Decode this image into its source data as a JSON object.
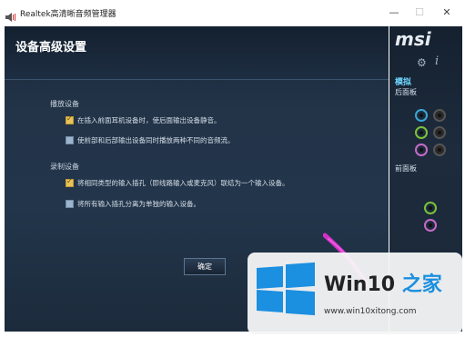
{
  "window": {
    "title": "Realtek高清晰音频管理器",
    "minimize_glyph": "—",
    "maximize_glyph": "☐",
    "close_glyph": "✕"
  },
  "page": {
    "title": "设备高级设置"
  },
  "playback": {
    "section_label": "播放设备",
    "options": [
      {
        "label": "在插入前面耳机设备时，使后面输出设备静音。",
        "checked": true
      },
      {
        "label": "使前部和后部输出设备同时播放两种不同的音频流。",
        "checked": false
      }
    ]
  },
  "recording": {
    "section_label": "录制设备",
    "options": [
      {
        "label": "将相同类型的输入插孔（即线路输入或麦克风）联结为一个输入设备。",
        "checked": true
      },
      {
        "label": "将所有输入插孔分离为单独的输入设备。",
        "checked": false
      }
    ]
  },
  "ok_button": {
    "label": "确定"
  },
  "sidebar": {
    "logo": "msi",
    "mode_label": "模拟",
    "rear_panel_label": "后面板",
    "front_panel_label": "前面板"
  },
  "watermark": {
    "brand_text": "Win10",
    "brand_zh": "之家",
    "url": "www.win10xitong.com"
  },
  "colors": {
    "accent": "#6fd6ff",
    "windows_blue": "#1b8fe0",
    "checkbox_checked": "#e8c25a",
    "checkbox_unchecked": "#9cb4cc",
    "jack_blue": "#3aa6d6",
    "jack_green": "#7bc23a",
    "jack_pink": "#c86ac8",
    "jack_dark": "#555555",
    "swipe_magenta": "#d62fc8"
  }
}
